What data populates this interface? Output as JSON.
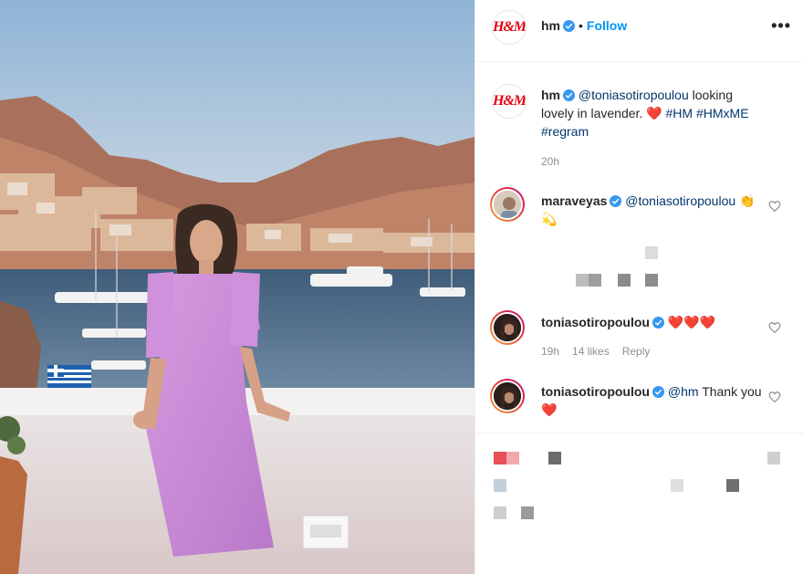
{
  "post": {
    "author": "hm",
    "follow_label": "Follow",
    "more_label": "•••",
    "caption": {
      "author": "hm",
      "mention": "@toniasotiropoulou",
      "text": "looking lovely in lavender.",
      "emoji": "❤️",
      "tags": [
        "#HM",
        "#HMxME",
        "#regram"
      ],
      "time": "20h"
    }
  },
  "comments": [
    {
      "author": "maraveyas",
      "mention": "@toniasotiropoulou",
      "text": "👏💫"
    },
    {
      "author": "toniasotiropoulou",
      "text": "❤️❤️❤️",
      "time": "19h",
      "likes": "14 likes",
      "reply_label": "Reply"
    },
    {
      "author": "toniasotiropoulou",
      "mention": "@hm",
      "text": "Thank you",
      "emoji": "❤️"
    }
  ],
  "icons": {
    "verified": "verified-badge-icon",
    "heart": "heart-outline-icon",
    "more": "more-options-icon"
  },
  "colors": {
    "accent": "#0095f6",
    "link": "#00376b",
    "verified": "#3897f0",
    "brand_red": "#e50010",
    "heart": "#ed4956"
  }
}
